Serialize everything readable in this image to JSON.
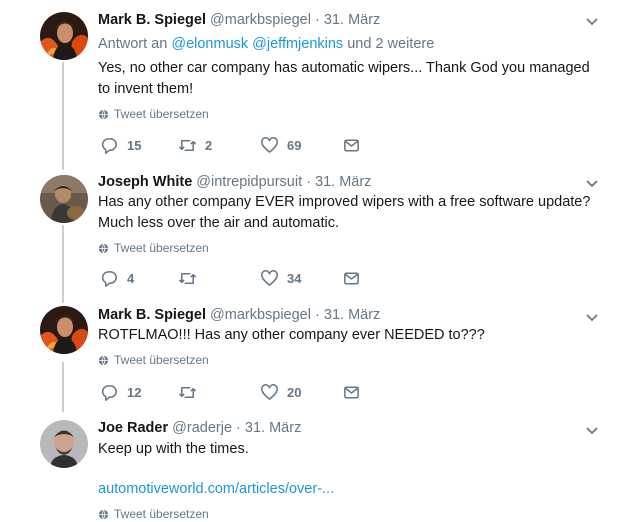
{
  "tweets": [
    {
      "name": "Mark B. Spiegel",
      "handle": "@markbspiegel",
      "date": "31. März",
      "reply_prefix": "Antwort an",
      "reply_mentions": [
        "@elonmusk",
        "@jeffmjenkins"
      ],
      "reply_suffix": "und 2 weitere",
      "text": "Yes, no other car company has automatic wipers... Thank God you managed to invent them!",
      "translate": "Tweet übersetzen",
      "replies": "15",
      "retweets": "2",
      "likes": "69"
    },
    {
      "name": "Joseph White",
      "handle": "@intrepidpursuit",
      "date": "31. März",
      "text": "Has any other company EVER improved wipers with a free software update? Much less over the air and automatic.",
      "translate": "Tweet übersetzen",
      "replies": "4",
      "retweets": "",
      "likes": "34"
    },
    {
      "name": "Mark B. Spiegel",
      "handle": "@markbspiegel",
      "date": "31. März",
      "text": "ROTFLMAO!!! Has any other company ever NEEDED to???",
      "translate": "Tweet übersetzen",
      "replies": "12",
      "retweets": "",
      "likes": "20"
    },
    {
      "name": "Joe Rader",
      "handle": "@raderje",
      "date": "31. März",
      "text": "Keep up with the times.",
      "link": "automotiveworld.com/articles/over-...",
      "translate": "Tweet übersetzen"
    }
  ],
  "separator": "·",
  "colors": {
    "link": "#1b95e0",
    "secondary": "#657786",
    "thread_line": "#c4cfd6"
  },
  "icons": [
    "reply-icon",
    "retweet-icon",
    "like-icon",
    "direct-message-icon",
    "globe-icon",
    "chevron-down-icon"
  ]
}
